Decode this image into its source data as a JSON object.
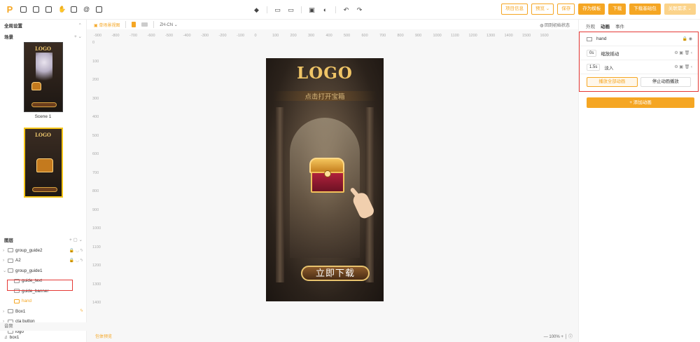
{
  "toolbar": {
    "project_info": "项目信息",
    "preview": "预览",
    "save": "保存",
    "save_template": "存为模板",
    "download": "下载",
    "download_base": "下载基础包",
    "related_needs": "关联需求"
  },
  "left": {
    "global_settings": "全局设置",
    "scenes_title": "场景",
    "scene1_label": "Scene 1",
    "layers_title": "图层",
    "layers": [
      {
        "name": "group_guide2"
      },
      {
        "name": "A2"
      },
      {
        "name": "group_guide1"
      },
      {
        "name": "guide_text"
      },
      {
        "name": "guide_banner"
      },
      {
        "name": "hand"
      },
      {
        "name": "Box1"
      },
      {
        "name": "cta button"
      },
      {
        "name": "logo"
      }
    ],
    "audio_title": "音频",
    "audio_item": "box1"
  },
  "canvas": {
    "single_scene": "单场景视图",
    "lang": "ZH-CN",
    "reset": "回到初始状态",
    "bottom_link": "包体预览",
    "zoom": "100%",
    "ruler_x": [
      "-900",
      "-800",
      "-700",
      "-600",
      "-500",
      "-400",
      "-300",
      "-200",
      "-100",
      "0",
      "100",
      "200",
      "300",
      "400",
      "500",
      "600",
      "700",
      "800",
      "900",
      "1000",
      "1100",
      "1200",
      "1300",
      "1400",
      "1500",
      "1600"
    ],
    "ruler_y": [
      "0",
      "100",
      "200",
      "300",
      "400",
      "500",
      "600",
      "700",
      "800",
      "900",
      "1000",
      "1100",
      "1200",
      "1300",
      "1400"
    ],
    "phone_logo": "LOGO",
    "phone_sub": "点击打开宝箱",
    "phone_btn": "立即下载"
  },
  "right": {
    "tabs": [
      "外观",
      "动画",
      "事件"
    ],
    "target": "hand",
    "anims": [
      {
        "time": "0s",
        "name": "缩放摇动"
      },
      {
        "time": "1.5s",
        "name": "淡入"
      }
    ],
    "play_all": "播放全部动画",
    "stop_all": "停止动画播放",
    "add_anim": "+ 添加动画"
  }
}
